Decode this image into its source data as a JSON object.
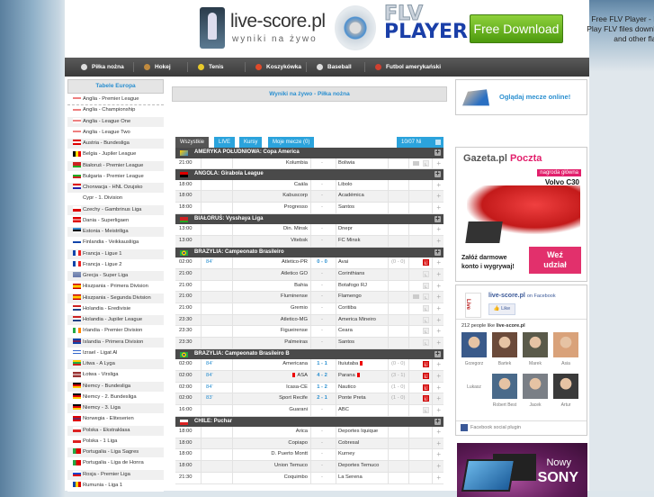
{
  "header": {
    "logo_title": "live-score.pl",
    "logo_subtitle": "wyniki na żywo",
    "flv_line1": "FLV",
    "flv_line2": "PLAYER",
    "download_button": "Free Download",
    "flv_desc": [
      "Free FLV Player - Flash",
      "Play FLV files downloade",
      "and other flash vi"
    ]
  },
  "nav": [
    {
      "label": "Piłka nożna",
      "icon": "soccer-ball-icon",
      "color": "#dddddd"
    },
    {
      "label": "Hokej",
      "icon": "hockey-stick-icon",
      "color": "#c08a3e"
    },
    {
      "label": "Tenis",
      "icon": "tennis-ball-icon",
      "color": "#e8c92a"
    },
    {
      "label": "Koszykówka",
      "icon": "basketball-icon",
      "color": "#e04a2a"
    },
    {
      "label": "Baseball",
      "icon": "baseball-icon",
      "color": "#dddddd"
    },
    {
      "label": "Futbol amerykański",
      "icon": "football-icon",
      "color": "#d04030"
    }
  ],
  "sidebar": {
    "title": "Tabele Europa",
    "items": [
      {
        "label": "Anglia - Premier League",
        "flag": "eng"
      },
      {
        "label": "Anglia - Championship",
        "flag": "eng"
      },
      {
        "label": "Anglia - League One",
        "flag": "eng"
      },
      {
        "label": "Anglia - League Two",
        "flag": "eng"
      },
      {
        "label": "Austria - Bundesliga",
        "flag": "aut"
      },
      {
        "label": "Belgia - Jupiler League",
        "flag": "bel"
      },
      {
        "label": "Białoruś - Premier League",
        "flag": "blr"
      },
      {
        "label": "Bułgaria - Premier League",
        "flag": "bgr"
      },
      {
        "label": "Chorwacja - HNL Ozujsko",
        "flag": "hrv"
      },
      {
        "label": "Cypr - 1. Division",
        "flag": "cyp"
      },
      {
        "label": "Czechy - Gambrinus Liga",
        "flag": "cze"
      },
      {
        "label": "Dania - Superligaen",
        "flag": "dnk"
      },
      {
        "label": "Estonia - Meistriliga",
        "flag": "est"
      },
      {
        "label": "Finlandia - Veikkausliiga",
        "flag": "fin"
      },
      {
        "label": "Francja - Ligue 1",
        "flag": "fra"
      },
      {
        "label": "Francja - Ligue 2",
        "flag": "fra"
      },
      {
        "label": "Grecja - Super Liga",
        "flag": "grc"
      },
      {
        "label": "Hiszpania - Primera Division",
        "flag": "esp"
      },
      {
        "label": "Hiszpania - Segunda Division",
        "flag": "esp"
      },
      {
        "label": "Holandia - Eredivisie",
        "flag": "nld"
      },
      {
        "label": "Holandia - Jupiler League",
        "flag": "nld"
      },
      {
        "label": "Irlandia - Premier Division",
        "flag": "irl"
      },
      {
        "label": "Islandia - Primera Division",
        "flag": "isl"
      },
      {
        "label": "Izrael - Ligat Al",
        "flag": "isr"
      },
      {
        "label": "Litwa - A Lyga",
        "flag": "ltu"
      },
      {
        "label": "Łotwa - Virsliga",
        "flag": "lva"
      },
      {
        "label": "Niemcy - Bundesliga",
        "flag": "deu"
      },
      {
        "label": "Niemcy - 2. Bundesliga",
        "flag": "deu"
      },
      {
        "label": "Niemcy - 3. Liga",
        "flag": "deu"
      },
      {
        "label": "Norwegia - Eliteserien",
        "flag": "nor"
      },
      {
        "label": "Polska - Ekstraklasa",
        "flag": "pol"
      },
      {
        "label": "Polska - 1 Liga",
        "flag": "pol"
      },
      {
        "label": "Portugalia - Liga Sagres",
        "flag": "prt"
      },
      {
        "label": "Portugalia - Liga de Honra",
        "flag": "prt"
      },
      {
        "label": "Rosja - Premier Liga",
        "flag": "rus"
      },
      {
        "label": "Rumunia - Liga 1",
        "flag": "rou"
      }
    ]
  },
  "main": {
    "title": "Wyniki na żywo - Piłka nożna",
    "tabs": [
      {
        "label": "Wszystkie",
        "active": true
      },
      {
        "label": "LIVE",
        "active": false
      },
      {
        "label": "Kursy",
        "active": false
      },
      {
        "label": "Moje mecze (0)",
        "active": false
      }
    ],
    "date": "10/07 Ni",
    "groups": [
      {
        "title": "AMERYKA POŁUDNIOWA: Copa America",
        "flag": "sam",
        "matches": [
          {
            "time": "21:00",
            "minute": "",
            "home": "Kolumbia",
            "score": "-",
            "away": "Boliwia",
            "ht": "",
            "tv": true,
            "l": "off"
          }
        ]
      },
      {
        "title": "ANGOLA: Girabola League",
        "flag": "ago",
        "matches": [
          {
            "time": "18:00",
            "minute": "",
            "home": "Caála",
            "score": "-",
            "away": "Libolo",
            "ht": "",
            "tv": false,
            "l": ""
          },
          {
            "time": "18:00",
            "minute": "",
            "home": "Kabuscorp",
            "score": "-",
            "away": "Académica",
            "ht": "",
            "tv": false,
            "l": ""
          },
          {
            "time": "18:00",
            "minute": "",
            "home": "Progresso",
            "score": "-",
            "away": "Santos",
            "ht": "",
            "tv": false,
            "l": ""
          }
        ]
      },
      {
        "title": "BIAŁORUŚ: Vysshaya Liga",
        "flag": "blr",
        "matches": [
          {
            "time": "13:00",
            "minute": "",
            "home": "Din. Minsk",
            "score": "-",
            "away": "Dnepr",
            "ht": "",
            "tv": false,
            "l": ""
          },
          {
            "time": "13:00",
            "minute": "",
            "home": "Vitebsk",
            "score": "-",
            "away": "FC Minsk",
            "ht": "",
            "tv": false,
            "l": ""
          }
        ]
      },
      {
        "title": "BRAZYLIA: Campeonato Brasileiro",
        "flag": "bra",
        "matches": [
          {
            "time": "02:00",
            "minute": "84'",
            "home": "Atletico-PR",
            "score": "0 - 0",
            "away": "Avai",
            "ht": "(0 - 0)",
            "tv": false,
            "l": "on"
          },
          {
            "time": "21:00",
            "minute": "",
            "home": "Atletico GO",
            "score": "-",
            "away": "Corinthians",
            "ht": "",
            "tv": false,
            "l": "off"
          },
          {
            "time": "21:00",
            "minute": "",
            "home": "Bahia",
            "score": "-",
            "away": "Botafogo RJ",
            "ht": "",
            "tv": false,
            "l": "off"
          },
          {
            "time": "21:00",
            "minute": "",
            "home": "Fluminense",
            "score": "-",
            "away": "Flamengo",
            "ht": "",
            "tv": true,
            "l": "off"
          },
          {
            "time": "21:00",
            "minute": "",
            "home": "Gremio",
            "score": "-",
            "away": "Coritiba",
            "ht": "",
            "tv": false,
            "l": "off"
          },
          {
            "time": "23:30",
            "minute": "",
            "home": "Atletico-MG",
            "score": "-",
            "away": "America Mineiro",
            "ht": "",
            "tv": false,
            "l": "off"
          },
          {
            "time": "23:30",
            "minute": "",
            "home": "Figueirense",
            "score": "-",
            "away": "Ceara",
            "ht": "",
            "tv": false,
            "l": "off"
          },
          {
            "time": "23:30",
            "minute": "",
            "home": "Palmeiras",
            "score": "-",
            "away": "Santos",
            "ht": "",
            "tv": false,
            "l": "off"
          }
        ]
      },
      {
        "title": "BRAZYLIA: Campeonato Brasileiro B",
        "flag": "bra",
        "matches": [
          {
            "time": "02:00",
            "minute": "84'",
            "home": "Americana",
            "score": "1 - 1",
            "away": "Ituiutaba",
            "away_red": true,
            "ht": "(0 - 0)",
            "tv": false,
            "l": "on"
          },
          {
            "time": "02:00",
            "minute": "84'",
            "home": "ASA",
            "home_red": true,
            "score": "4 - 2",
            "away": "Parana",
            "away_red": true,
            "ht": "(3 - 1)",
            "tv": false,
            "l": "on"
          },
          {
            "time": "02:00",
            "minute": "84'",
            "home": "Icasa-CE",
            "score": "1 - 2",
            "away": "Nautico",
            "ht": "(1 - 0)",
            "tv": false,
            "l": "on"
          },
          {
            "time": "02:00",
            "minute": "83'",
            "home": "Sport Recife",
            "score": "2 - 1",
            "away": "Ponte Preta",
            "ht": "(1 - 0)",
            "tv": false,
            "l": "on"
          },
          {
            "time": "16:00",
            "minute": "",
            "home": "Guarani",
            "score": "-",
            "away": "ABC",
            "ht": "",
            "tv": false,
            "l": "off"
          }
        ]
      },
      {
        "title": "CHILE: Puchar",
        "flag": "chl",
        "matches": [
          {
            "time": "18:00",
            "minute": "",
            "home": "Arica",
            "score": "-",
            "away": "Deportes Iquique",
            "ht": "",
            "tv": false,
            "l": ""
          },
          {
            "time": "18:00",
            "minute": "",
            "home": "Copiapo",
            "score": "-",
            "away": "Cobresal",
            "ht": "",
            "tv": false,
            "l": ""
          },
          {
            "time": "18:00",
            "minute": "",
            "home": "D. Puerto Montt",
            "score": "-",
            "away": "Kurney",
            "ht": "",
            "tv": false,
            "l": ""
          },
          {
            "time": "18:00",
            "minute": "",
            "home": "Union Temuco",
            "score": "-",
            "away": "Deportes Temuco",
            "ht": "",
            "tv": false,
            "l": ""
          },
          {
            "time": "21:30",
            "minute": "",
            "home": "Coquimbo",
            "score": "-",
            "away": "La Serena",
            "ht": "",
            "tv": false,
            "l": ""
          }
        ]
      }
    ]
  },
  "right": {
    "watch_label": "Oglądaj mecze online!",
    "gazeta": {
      "logo_a": "Gazeta.pl",
      "logo_b": "Poczta",
      "badge": "nagroda główna",
      "model": "Volvo C30",
      "text": [
        "Załóż darmowe",
        "konto i wygrywaj!"
      ],
      "button": [
        "Weź",
        "udział"
      ]
    },
    "facebook": {
      "page_name": "live-score.pl",
      "on_label": "on Facebook",
      "like_label": "Like",
      "count_prefix": "212 people like",
      "count_page": "live-score.pl",
      "fans": [
        {
          "name": "Grzegorz",
          "color": "#3a5a8a"
        },
        {
          "name": "Bartek",
          "color": "#6b4a3a"
        },
        {
          "name": "Marek",
          "color": "#5a5a4a"
        },
        {
          "name": "Asia",
          "color": "#d9a27a"
        },
        {
          "name": "Lukasz",
          "color": ""
        },
        {
          "name": "Robert Best",
          "color": "#4a6a8a"
        },
        {
          "name": "Jacek",
          "color": "#7a7f86"
        },
        {
          "name": "Artur",
          "color": "#3a3a3a"
        }
      ],
      "footer": "Facebook social plugin"
    },
    "sony": {
      "line1": "Nowy",
      "line2": "SONY"
    }
  }
}
